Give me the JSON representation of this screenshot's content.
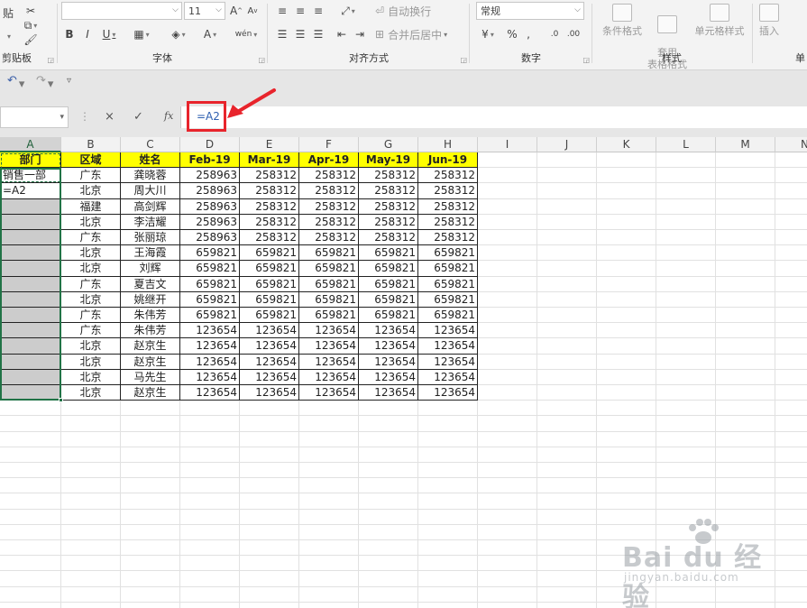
{
  "ribbon": {
    "clipboard": {
      "paste_label": "贴",
      "group_label": "剪贴板"
    },
    "font": {
      "font_name": "",
      "font_size": "11",
      "group_label": "字体",
      "bold": "B",
      "italic": "I",
      "underline": "U",
      "grow": "A",
      "shrink": "A",
      "font_color": "A",
      "phonetic": "wén"
    },
    "alignment": {
      "wrap_text": "自动换行",
      "merge_center": "合并后居中",
      "group_label": "对齐方式"
    },
    "number": {
      "format": "常规",
      "percent": "%",
      "group_label": "数字"
    },
    "styles": {
      "conditional": "条件格式",
      "table_format": "套用\n表格格式",
      "cell_styles": "单元格样式",
      "group_label": "样式"
    },
    "cells": {
      "insert": "插入",
      "group_label": "单"
    }
  },
  "formula_bar": {
    "name_box": "",
    "formula": "=A2",
    "cancel_icon": "×",
    "enter_icon": "✓",
    "fx_icon": "fx"
  },
  "columns": [
    "A",
    "B",
    "C",
    "D",
    "E",
    "F",
    "G",
    "H",
    "I",
    "J",
    "K",
    "L",
    "M",
    "N"
  ],
  "table": {
    "header": [
      "部门",
      "区域",
      "姓名",
      "Feb-19",
      "Mar-19",
      "Apr-19",
      "May-19",
      "Jun-19"
    ],
    "rows": [
      [
        "销售一部",
        "广东",
        "龚晓蓉",
        "258963",
        "258312",
        "258312",
        "258312",
        "258312"
      ],
      [
        "=A2",
        "北京",
        "周大川",
        "258963",
        "258312",
        "258312",
        "258312",
        "258312"
      ],
      [
        "",
        "福建",
        "高剑辉",
        "258963",
        "258312",
        "258312",
        "258312",
        "258312"
      ],
      [
        "",
        "北京",
        "李洁耀",
        "258963",
        "258312",
        "258312",
        "258312",
        "258312"
      ],
      [
        "",
        "广东",
        "张丽琼",
        "258963",
        "258312",
        "258312",
        "258312",
        "258312"
      ],
      [
        "",
        "北京",
        "王海霞",
        "659821",
        "659821",
        "659821",
        "659821",
        "659821"
      ],
      [
        "",
        "北京",
        "刘辉",
        "659821",
        "659821",
        "659821",
        "659821",
        "659821"
      ],
      [
        "",
        "广东",
        "夏吉文",
        "659821",
        "659821",
        "659821",
        "659821",
        "659821"
      ],
      [
        "",
        "北京",
        "姚继开",
        "659821",
        "659821",
        "659821",
        "659821",
        "659821"
      ],
      [
        "",
        "广东",
        "朱伟芳",
        "659821",
        "659821",
        "659821",
        "659821",
        "659821"
      ],
      [
        "",
        "广东",
        "朱伟芳",
        "123654",
        "123654",
        "123654",
        "123654",
        "123654"
      ],
      [
        "",
        "北京",
        "赵京生",
        "123654",
        "123654",
        "123654",
        "123654",
        "123654"
      ],
      [
        "",
        "北京",
        "赵京生",
        "123654",
        "123654",
        "123654",
        "123654",
        "123654"
      ],
      [
        "",
        "北京",
        "马先生",
        "123654",
        "123654",
        "123654",
        "123654",
        "123654"
      ],
      [
        "",
        "北京",
        "赵京生",
        "123654",
        "123654",
        "123654",
        "123654",
        "123654"
      ]
    ]
  },
  "watermark": {
    "brand": "Bai du 经验",
    "url": "jingyan.baidu.com"
  },
  "colors": {
    "highlight_red": "#e8242c",
    "header_yellow": "#ffff00",
    "selection_green": "#217346",
    "blank_grey": "#cccccc"
  }
}
